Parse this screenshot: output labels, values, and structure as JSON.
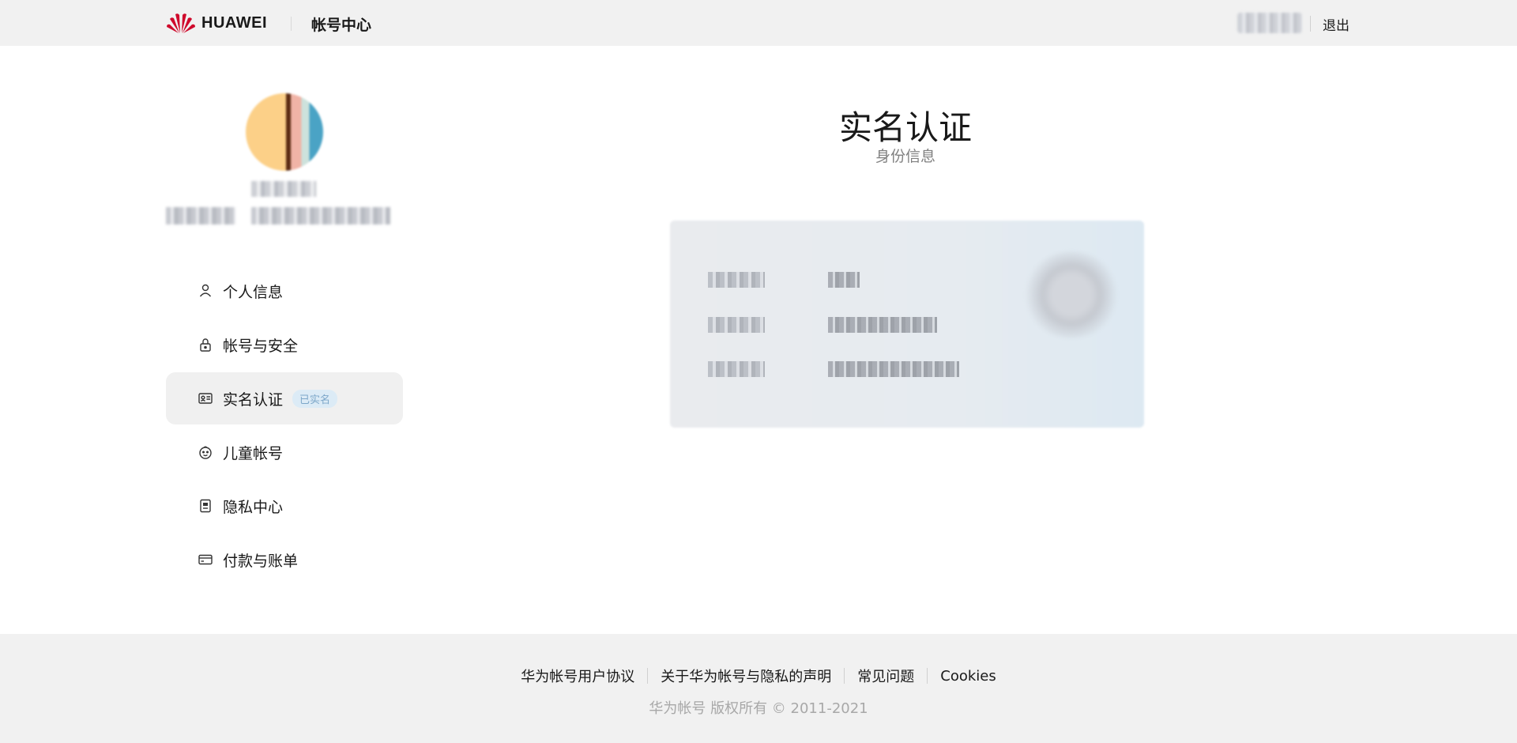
{
  "header": {
    "brand": "HUAWEI",
    "app_title": "帐号中心",
    "logout": "退出"
  },
  "sidebar": {
    "items": [
      {
        "label": "个人信息",
        "icon": "user-icon"
      },
      {
        "label": "帐号与安全",
        "icon": "lock-icon"
      },
      {
        "label": "实名认证",
        "icon": "id-card-icon",
        "badge": "已实名",
        "active": true
      },
      {
        "label": "儿童帐号",
        "icon": "child-face-icon"
      },
      {
        "label": "隐私中心",
        "icon": "privacy-doc-icon"
      },
      {
        "label": "付款与账单",
        "icon": "credit-card-icon"
      }
    ]
  },
  "main": {
    "title": "实名认证",
    "subtitle": "身份信息"
  },
  "footer": {
    "links": [
      "华为帐号用户协议",
      "关于华为帐号与隐私的声明",
      "常见问题",
      "Cookies"
    ],
    "copyright": "华为帐号 版权所有 © 2011-2021"
  },
  "colors": {
    "header_bg": "#f1f1f1",
    "brand_red": "#cf0a2c",
    "active_item_bg": "#f0f0f0",
    "badge_bg": "#dcebf6",
    "badge_text": "#7da7c9"
  }
}
